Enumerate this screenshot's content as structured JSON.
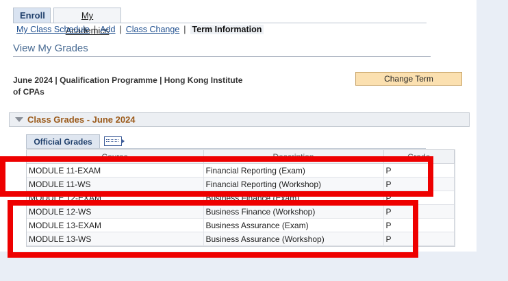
{
  "tabs": [
    {
      "label": "Enroll"
    },
    {
      "label": "My Academics"
    }
  ],
  "subnav": {
    "items": [
      "My Class Schedule",
      "Add",
      "Class Change"
    ],
    "separator": "|",
    "current": "Term Information"
  },
  "page": {
    "title": "View My Grades",
    "term_info": "June 2024 | Qualification Programme | Hong Kong Institute of CPAs",
    "change_term_label": "Change Term"
  },
  "section": {
    "title": "Class Grades - June 2024"
  },
  "grid": {
    "tab_label": "Official Grades",
    "icon": "grid-view-icon",
    "columns": [
      "Course",
      "Description",
      "Grade"
    ],
    "rows": [
      {
        "course": "MODULE 11-EXAM",
        "description": "Financial Reporting (Exam)",
        "grade": "P"
      },
      {
        "course": "MODULE 11-WS",
        "description": "Financial Reporting (Workshop)",
        "grade": "P"
      },
      {
        "course": "MODULE 12-EXAM",
        "description": "Business Finance (Exam)",
        "grade": "P"
      },
      {
        "course": "MODULE 12-WS",
        "description": "Business Finance (Workshop)",
        "grade": "P"
      },
      {
        "course": "MODULE 13-EXAM",
        "description": "Business Assurance (Exam)",
        "grade": "P"
      },
      {
        "course": "MODULE 13-WS",
        "description": "Business Assurance (Workshop)",
        "grade": "P"
      }
    ]
  },
  "colors": {
    "highlight_box": "#ee0000",
    "section_title": "#9b5a1a",
    "link": "#1f4f8f",
    "button_bg": "#fbe0b0"
  }
}
